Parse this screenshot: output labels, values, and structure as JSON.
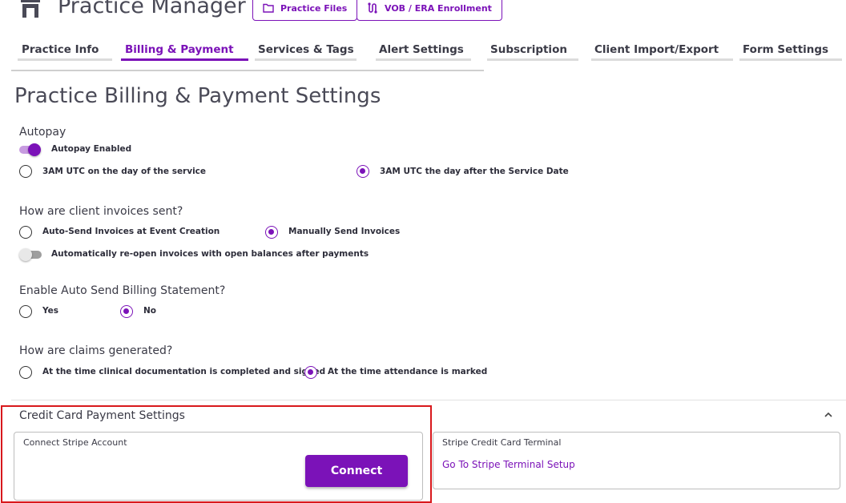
{
  "header": {
    "title": "Practice Manager",
    "icon": "store-icon",
    "buttons": [
      {
        "label": "Practice Files",
        "icon": "folder-icon"
      },
      {
        "label": "VOB / ERA Enrollment",
        "icon": "route-icon"
      }
    ]
  },
  "tabs": [
    {
      "label": "Practice Info",
      "active": false
    },
    {
      "label": "Billing & Payment",
      "active": true
    },
    {
      "label": "Services & Tags",
      "active": false
    },
    {
      "label": "Alert Settings",
      "active": false
    },
    {
      "label": "Subscription",
      "active": false
    },
    {
      "label": "Client Import/Export",
      "active": false
    },
    {
      "label": "Form Settings",
      "active": false
    }
  ],
  "page": {
    "title": "Practice Billing & Payment Settings"
  },
  "autopay": {
    "label": "Autopay",
    "toggle_label": "Autopay Enabled",
    "enabled": true,
    "options": [
      {
        "label": "3AM UTC on the day of the service",
        "checked": false
      },
      {
        "label": "3AM UTC the day after the Service Date",
        "checked": true
      }
    ]
  },
  "invoices": {
    "label": "How are client invoices sent?",
    "options": [
      {
        "label": "Auto-Send Invoices at Event Creation",
        "checked": false
      },
      {
        "label": "Manually Send Invoices",
        "checked": true
      }
    ],
    "reopen_toggle_label": "Automatically re-open invoices with open balances after payments",
    "reopen_enabled": false
  },
  "statement": {
    "label": "Enable Auto Send Billing Statement?",
    "options": [
      {
        "label": "Yes",
        "checked": false
      },
      {
        "label": "No",
        "checked": true
      }
    ]
  },
  "claims": {
    "label": "How are claims generated?",
    "options": [
      {
        "label": "At the time clinical documentation is completed and signed",
        "checked": false
      },
      {
        "label": "At the time attendance is marked",
        "checked": true
      }
    ]
  },
  "credit_card": {
    "title": "Credit Card Payment Settings",
    "stripe_account_label": "Connect Stripe Account",
    "connect_button": "Connect",
    "terminal_label": "Stripe Credit Card Terminal",
    "terminal_link": "Go To Stripe Terminal Setup"
  },
  "colors": {
    "accent": "#7b12b8",
    "highlight": "#d8181c"
  }
}
